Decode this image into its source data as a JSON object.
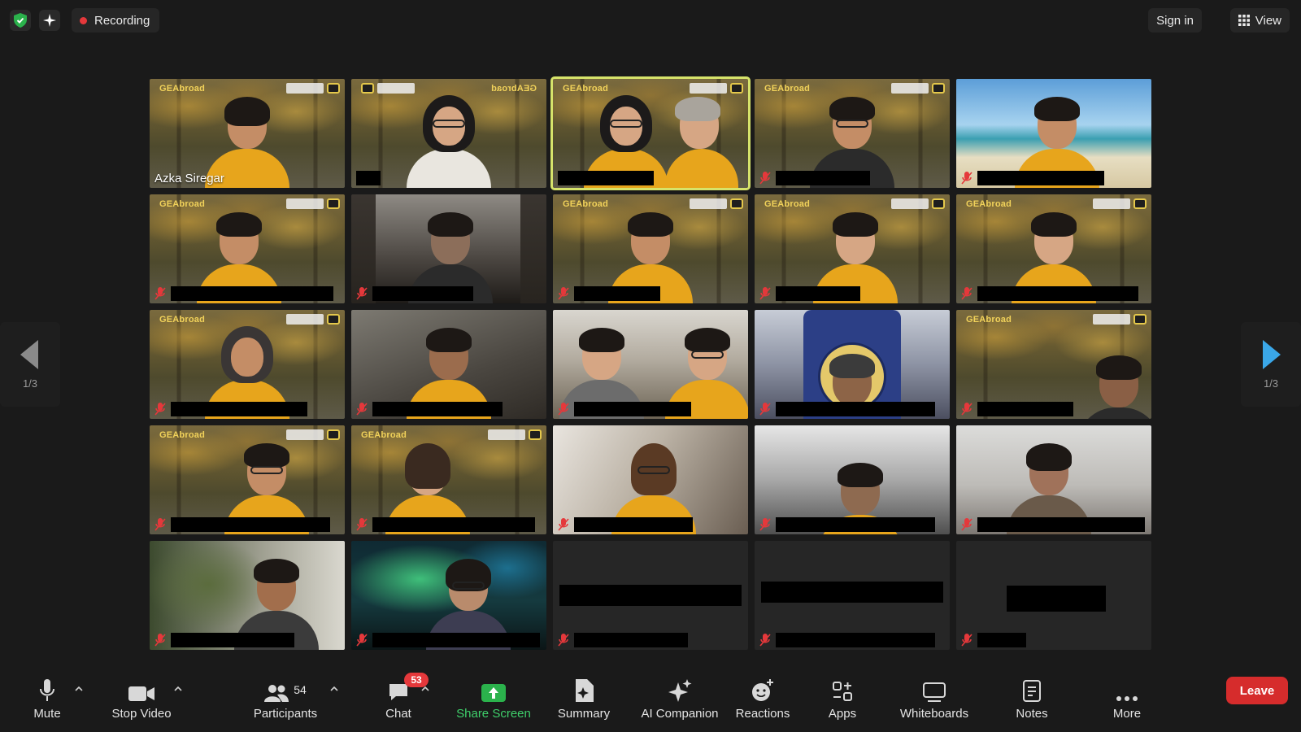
{
  "top_bar": {
    "recording_label": "Recording",
    "sign_in_label": "Sign in",
    "view_label": "View"
  },
  "page_nav": {
    "left_count": "1/3",
    "right_count": "1/3"
  },
  "tiles": [
    {
      "name": "Azka Siregar"
    }
  ],
  "toolbar": {
    "mute_label": "Mute",
    "stop_video_label": "Stop Video",
    "participants_label": "Participants",
    "participants_count": "54",
    "chat_label": "Chat",
    "chat_badge": "53",
    "share_screen_label": "Share Screen",
    "summary_label": "Summary",
    "ai_companion_label": "AI Companion",
    "reactions_label": "Reactions",
    "apps_label": "Apps",
    "whiteboards_label": "Whiteboards",
    "notes_label": "Notes",
    "more_label": "More",
    "leave_label": "Leave"
  },
  "brand": {
    "overlay_text": "GEAbroad"
  },
  "colors": {
    "background": "#1a1a1a",
    "active_speaker": "#d6e36a",
    "recording_dot": "#e5383b",
    "share_green": "#3fd06b",
    "leave_red": "#d62c2c",
    "brand_yellow": "#f1d25a"
  },
  "icons": {
    "security": "shield-check-icon",
    "ai": "sparkle-icon",
    "view": "grid-icon",
    "prev_page": "triangle-left-icon",
    "next_page": "triangle-right-icon",
    "muted": "mic-off-icon"
  }
}
